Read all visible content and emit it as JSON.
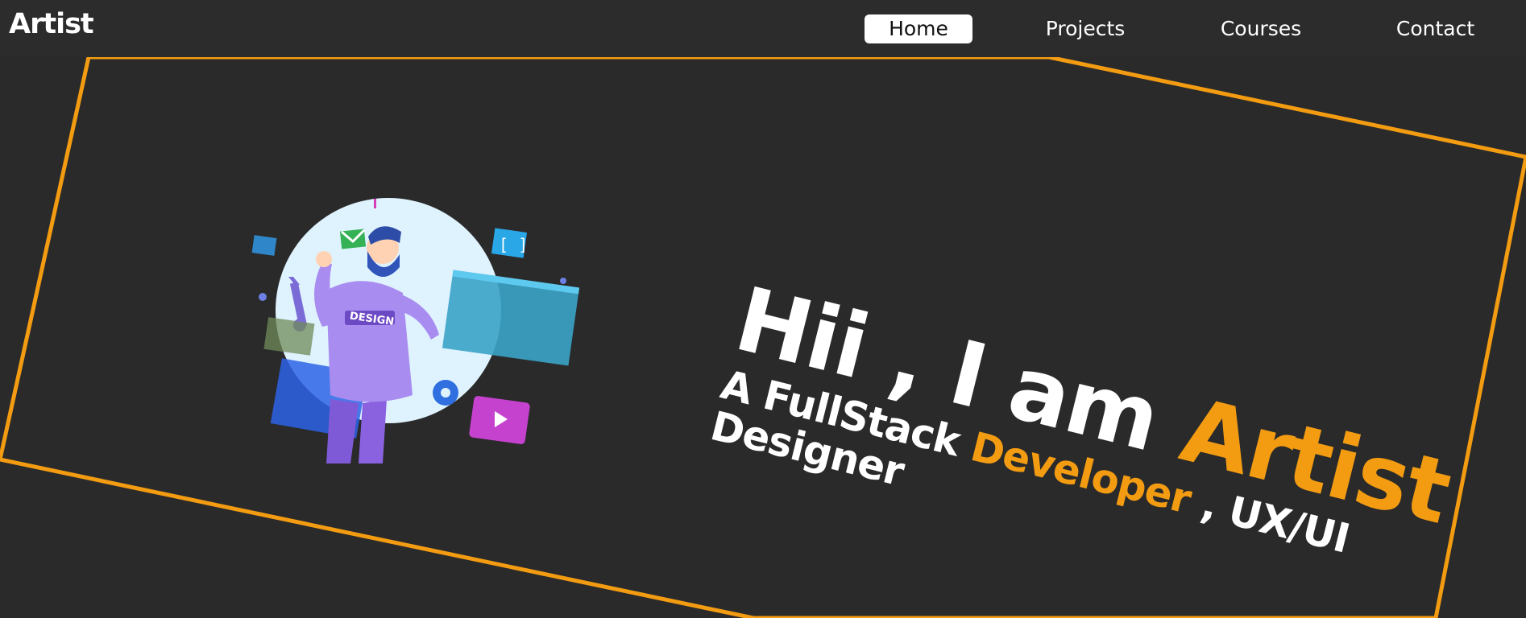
{
  "brand": {
    "name": "Artist"
  },
  "nav": {
    "items": [
      {
        "label": "Home",
        "active": true
      },
      {
        "label": "Projects",
        "active": false
      },
      {
        "label": "Courses",
        "active": false
      },
      {
        "label": "Contact",
        "active": false
      }
    ]
  },
  "hero": {
    "headline_prefix": "Hii , I am ",
    "headline_accent": "Artist",
    "subline_prefix": "A FullStack ",
    "subline_accent": "Developer",
    "subline_suffix": " , UX/UI Designer",
    "illustration_badge": "DESIGN",
    "illustration_code_icon": "[ ]"
  },
  "colors": {
    "background": "#2a2a2a",
    "navbar": "#2c2c2c",
    "accent": "#f39c12",
    "text": "#ffffff"
  },
  "icons": {
    "illustration": "designer-illustration",
    "wrench": "wrench-icon",
    "gear": "gear-icon",
    "mail": "mail-icon",
    "play": "play-icon",
    "code": "code-bracket-icon"
  }
}
